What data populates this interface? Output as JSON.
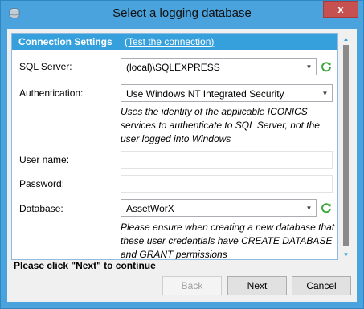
{
  "window": {
    "title": "Select a logging database",
    "close_glyph": "x",
    "icon": "app-database-icon",
    "accent_color": "#4aa3dc"
  },
  "section": {
    "title": "Connection Settings",
    "test_link": "(Test the connection)",
    "header_color": "#36a0dd"
  },
  "fields": {
    "sql_server": {
      "label": "SQL Server:",
      "value": "(local)\\SQLEXPRESS"
    },
    "authentication": {
      "label": "Authentication:",
      "value": "Use Windows NT Integrated Security",
      "hint": "Uses the identity of the applicable ICONICS services to authenticate to SQL Server, not the user logged into Windows"
    },
    "user_name": {
      "label": "User name:",
      "value": ""
    },
    "password": {
      "label": "Password:",
      "value": ""
    },
    "database": {
      "label": "Database:",
      "value": "AssetWorX",
      "hint": "Please ensure when creating a new database that these user credentials have CREATE DATABASE and GRANT permissions"
    }
  },
  "footer": {
    "message": "Please click \"Next\" to continue",
    "back_label": "Back",
    "next_label": "Next",
    "cancel_label": "Cancel"
  }
}
